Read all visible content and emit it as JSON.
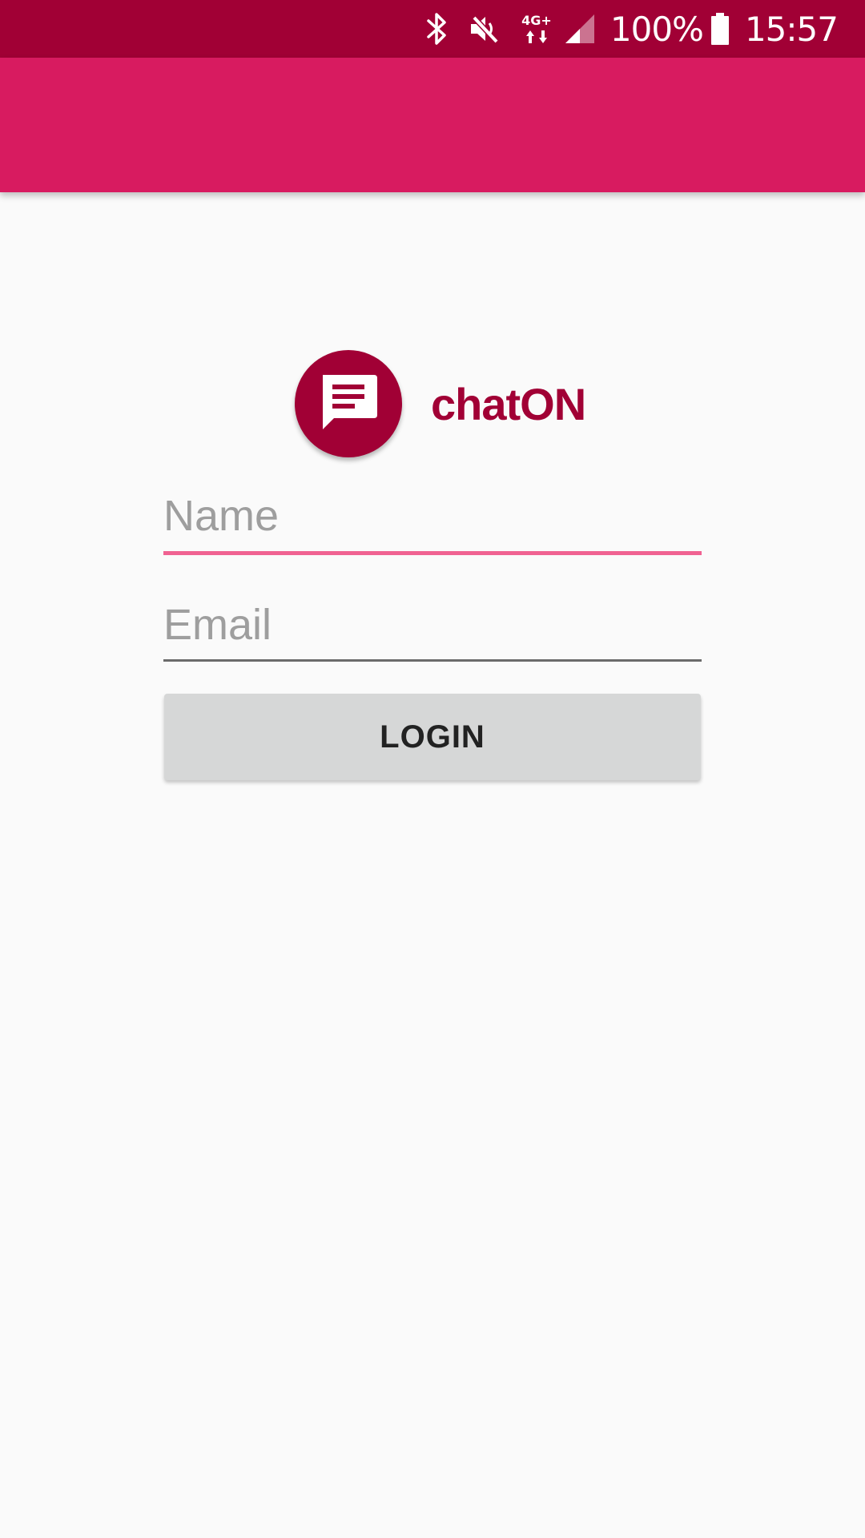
{
  "status_bar": {
    "icons": [
      "bluetooth-icon",
      "mute-icon",
      "network-4g-plus-icon",
      "signal-icon",
      "battery-icon"
    ],
    "network_label": "4G+",
    "battery_percent": "100%",
    "time": "15:57"
  },
  "app": {
    "name": "chatON",
    "logo_icon": "chat-bubble-icon"
  },
  "form": {
    "name_placeholder": "Name",
    "name_value": "",
    "email_placeholder": "Email",
    "email_value": "",
    "login_label": "LOGIN"
  },
  "colors": {
    "status_bar": "#a10035",
    "app_bar": "#d81b60",
    "accent": "#a10035",
    "focused_underline": "#f06292",
    "button_bg": "#d6d7d7",
    "background": "#fafafa"
  }
}
